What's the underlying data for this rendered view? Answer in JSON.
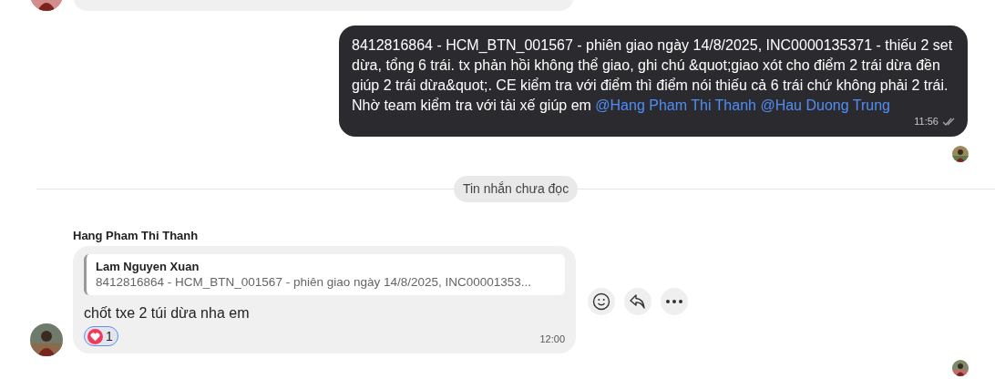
{
  "outgoing_message": {
    "text": "8412816864 - HCM_BTN_001567 - phiên giao ngày 14/8/2025, INC0000135371 - thiếu 2 set dừa, tổng 6 trái. tx phản hồi không thể giao, ghi chú &quot;giao xót cho điểm 2 trái dừa đền giúp 2 trái dừa&quot;. CE kiểm tra với điểm thì điểm nói thiếu cả 6 trái chứ không phải 2 trái. Nhờ team kiểm tra với tài xế giúp em",
    "mentions": [
      "@Hang Pham Thi Thanh",
      "@Hau Duong Trung"
    ],
    "time": "11:56",
    "seen": true
  },
  "divider": {
    "label": "Tin nhắn chưa đọc"
  },
  "incoming_message": {
    "sender": "Hang Pham Thi Thanh",
    "quote": {
      "author": "Lam Nguyen Xuan",
      "text": "8412816864 - HCM_BTN_001567 - phiên giao ngày 14/8/2025, INC00001353..."
    },
    "text": "chốt txe 2 túi dừa nha em",
    "time": "12:00",
    "reactions": [
      {
        "kind": "heart",
        "count": "1",
        "selected": true
      }
    ]
  }
}
